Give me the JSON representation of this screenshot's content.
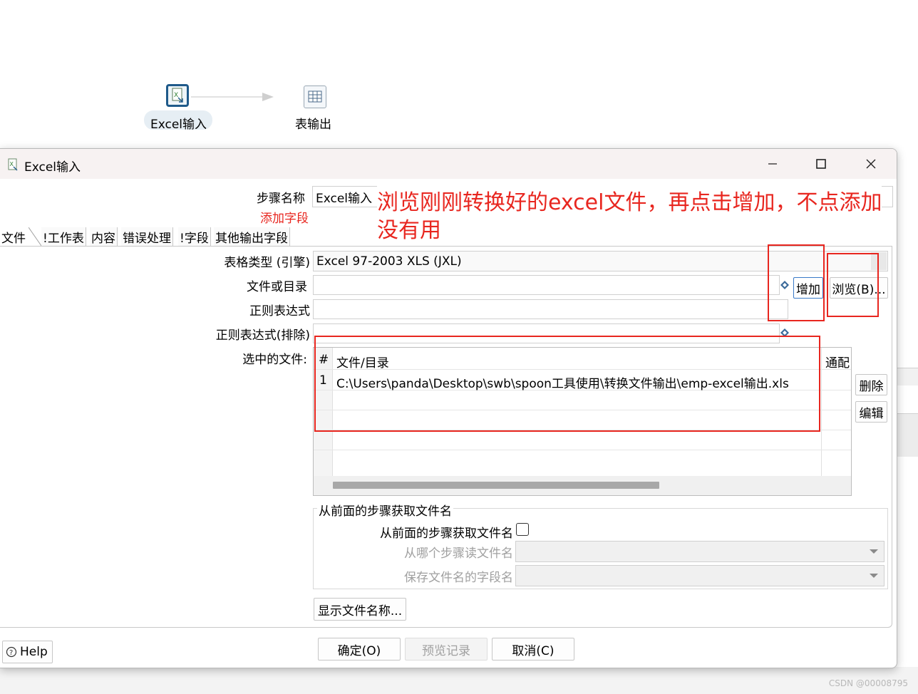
{
  "canvas": {
    "nodes": [
      {
        "label": "Excel输入",
        "icon": "excel-file-icon"
      },
      {
        "label": "表输出",
        "icon": "table-icon"
      }
    ]
  },
  "dialog": {
    "title": "Excel输入",
    "window_controls": {
      "minimize": "minimize-icon",
      "maximize": "maximize-icon",
      "close": "close-icon"
    },
    "step_name_label": "步骤名称",
    "step_name_value": "Excel输入",
    "add_fields_link": "添加字段",
    "annotation": {
      "line1": "浏览刚刚转换好的excel文件，再点击增加，不点添加",
      "line2": "没有用",
      "color": "#e8261f"
    },
    "tabs": [
      {
        "label": "文件",
        "active": true
      },
      {
        "label": "!工作表"
      },
      {
        "label": "内容"
      },
      {
        "label": "错误处理"
      },
      {
        "label": "!字段"
      },
      {
        "label": "其他输出字段"
      }
    ],
    "file_tab": {
      "spreadsheet_type_label": "表格类型 (引擎)",
      "spreadsheet_type_value": "Excel 97-2003 XLS (JXL)",
      "file_or_dir_label": "文件或目录",
      "file_or_dir_value": "",
      "add_button": "增加",
      "browse_button": "浏览(B)...",
      "regex_label": "正则表达式",
      "regex_value": "",
      "regex_exclude_label": "正则表达式(排除)",
      "regex_exclude_value": "",
      "selected_files_label": "选中的文件:",
      "table": {
        "columns": [
          "#",
          "文件/目录",
          "通配"
        ],
        "rows": [
          {
            "num": "1",
            "path": "C:\\Users\\panda\\Desktop\\swb\\spoon工具使用\\转换文件输出\\emp-excel输出.xls"
          }
        ]
      },
      "delete_button": "删除",
      "edit_button": "编辑",
      "prev_step_group": {
        "legend": "从前面的步骤获取文件名",
        "checkbox_label": "从前面的步骤获取文件名",
        "checkbox_checked": false,
        "read_step_label": "从哪个步骤读文件名",
        "read_step_value": "",
        "field_label": "保存文件名的字段名",
        "field_value": ""
      },
      "show_filenames_button": "显示文件名称..."
    },
    "footer": {
      "help": "Help",
      "ok": "确定(O)",
      "preview": "预览记录",
      "cancel": "取消(C)"
    }
  },
  "watermark": "CSDN @00008795"
}
